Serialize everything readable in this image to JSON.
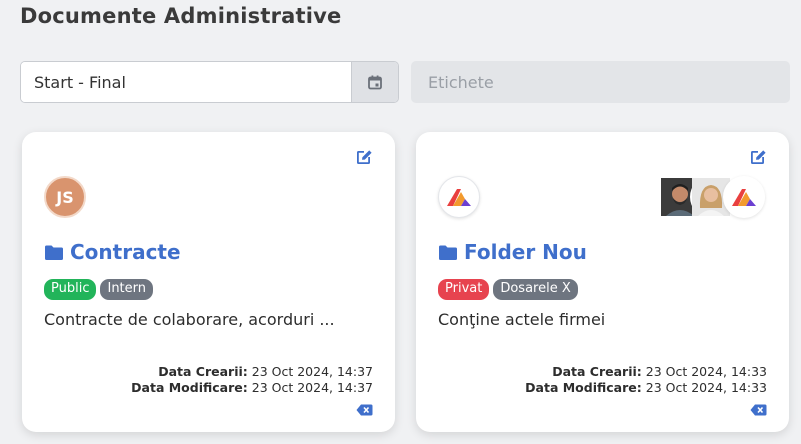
{
  "page": {
    "title": "Documente Administrative"
  },
  "filters": {
    "date_range_value": "Start - Final",
    "date_icon": "calendar-icon",
    "tags_placeholder": "Etichete"
  },
  "colors": {
    "folder_title": "#3f6fcb",
    "badge_public": "#22b45a",
    "badge_grey": "#6e7580",
    "badge_privat": "#e7434f",
    "avatar_initials_bg": "#d9946e"
  },
  "cards": [
    {
      "title": "Contracte",
      "folder_icon": "folder-icon",
      "owner_initials": "JS",
      "badges": [
        {
          "label": "Public",
          "color": "#22b45a"
        },
        {
          "label": "Intern",
          "color": "#6e7580"
        }
      ],
      "description": "Contracte de colaborare, acorduri ...",
      "created_label": "Data Crearii:",
      "created_value": " 23 Oct 2024, 14:37",
      "modified_label": "Data Modificare:",
      "modified_value": " 23 Oct 2024, 14:37"
    },
    {
      "title": "Folder Nou",
      "folder_icon": "folder-icon",
      "owner_logo": "company-logo-icon",
      "members": [
        "user-photo-man",
        "user-photo-woman",
        "company-logo-icon"
      ],
      "badges": [
        {
          "label": "Privat",
          "color": "#e7434f"
        },
        {
          "label": "Dosarele X",
          "color": "#6e7580"
        }
      ],
      "description": "Conţine actele firmei",
      "created_label": "Data Crearii:",
      "created_value": " 23 Oct 2024, 14:33",
      "modified_label": "Data Modificare:",
      "modified_value": " 23 Oct 2024, 14:33"
    }
  ]
}
